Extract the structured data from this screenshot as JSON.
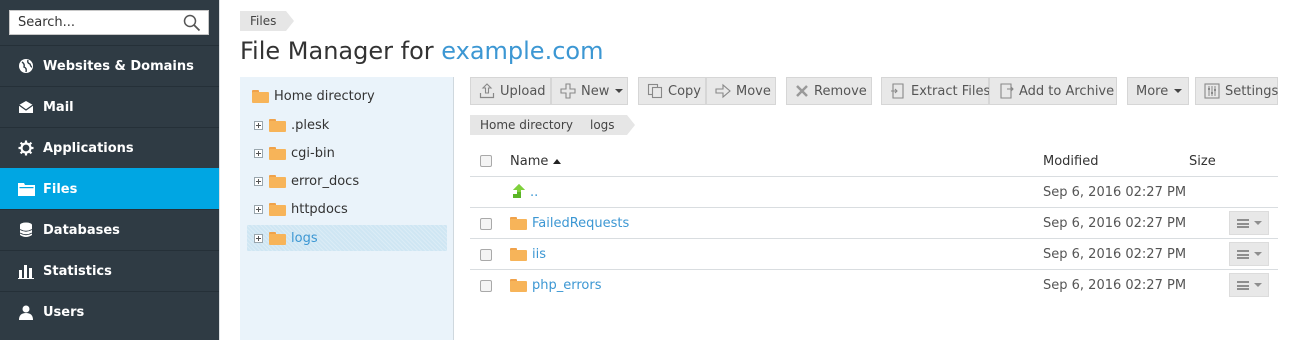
{
  "search": {
    "placeholder": "Search..."
  },
  "nav": {
    "items": [
      {
        "label": "Websites & Domains",
        "icon": "globe-icon"
      },
      {
        "label": "Mail",
        "icon": "envelope-icon"
      },
      {
        "label": "Applications",
        "icon": "gear-icon"
      },
      {
        "label": "Files",
        "icon": "folder-icon",
        "active": true
      },
      {
        "label": "Databases",
        "icon": "database-icon"
      },
      {
        "label": "Statistics",
        "icon": "bar-chart-icon"
      },
      {
        "label": "Users",
        "icon": "user-icon"
      }
    ]
  },
  "breadcrumb": {
    "label": "Files"
  },
  "page": {
    "title_prefix": "File Manager for",
    "domain": "example.com"
  },
  "tree": {
    "root": "Home directory",
    "items": [
      ".plesk",
      "cgi-bin",
      "error_docs",
      "httpdocs",
      "logs"
    ],
    "selected": "logs"
  },
  "toolbar": {
    "upload": "Upload",
    "new": "New",
    "copy": "Copy",
    "move": "Move",
    "remove": "Remove",
    "extract": "Extract Files",
    "archive": "Add to Archive",
    "more": "More",
    "settings": "Settings"
  },
  "path": {
    "root": "Home directory",
    "current": "logs"
  },
  "table": {
    "headers": {
      "name": "Name",
      "modified": "Modified",
      "size": "Size"
    },
    "rows": [
      {
        "name": "..",
        "modified": "Sep 6, 2016 02:27 PM",
        "type": "up"
      },
      {
        "name": "FailedRequests",
        "modified": "Sep 6, 2016 02:27 PM",
        "type": "folder"
      },
      {
        "name": "iis",
        "modified": "Sep 6, 2016 02:27 PM",
        "type": "folder"
      },
      {
        "name": "php_errors",
        "modified": "Sep 6, 2016 02:27 PM",
        "type": "folder"
      }
    ]
  },
  "colors": {
    "sidebar": "#2f3b44",
    "active": "#00a6e3",
    "link": "#3c97d3",
    "folder": "#f7b459"
  }
}
